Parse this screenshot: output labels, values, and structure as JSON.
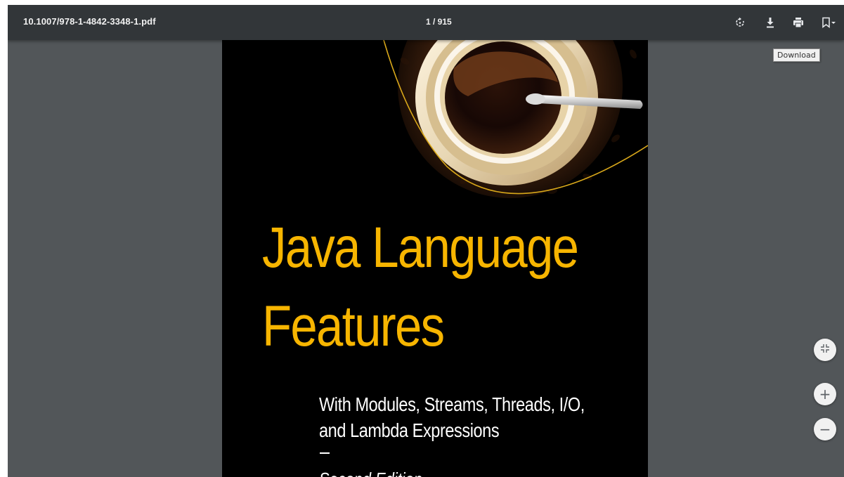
{
  "viewer": {
    "filename": "10.1007/978-1-4842-3348-1.pdf",
    "page_indicator": "1 / 915",
    "tooltip": "Download",
    "toolbar": {
      "rotate_icon": "rotate-icon",
      "download_icon": "download-icon",
      "print_icon": "print-icon",
      "bookmark_icon": "bookmark-icon"
    },
    "zoom": {
      "fit_icon": "fit-to-page-icon",
      "zoom_in_label": "+",
      "zoom_out_label": "−"
    }
  },
  "document": {
    "title_line1": "Java Language",
    "title_line2": "Features",
    "subtitle_line1": "With Modules, Streams, Threads, I/O,",
    "subtitle_line2": "and Lambda Expressions",
    "edition": "Second Edition"
  },
  "colors": {
    "toolbar_bg": "#323639",
    "viewer_bg": "#525659",
    "title_color": "#f7b500",
    "page_bg": "#000000"
  }
}
